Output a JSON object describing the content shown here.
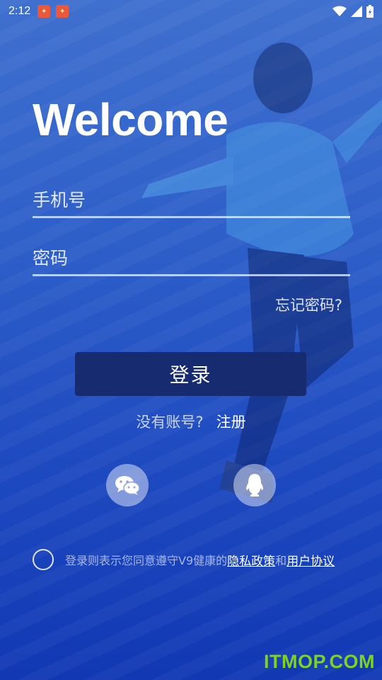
{
  "status_bar": {
    "time": "2:12",
    "icons": [
      "app-notification-icon",
      "app-notification-icon",
      "wifi-icon",
      "signal-icon",
      "battery-charging-icon"
    ]
  },
  "welcome_title": "Welcome",
  "phone_field": {
    "placeholder": "手机号",
    "value": ""
  },
  "password_field": {
    "placeholder": "密码",
    "value": ""
  },
  "forgot_password": "忘记密码?",
  "login_button": "登录",
  "register": {
    "prompt": "没有账号?",
    "link": "注册"
  },
  "social_login": [
    "wechat-icon",
    "qq-icon"
  ],
  "agreement": {
    "text": "登录则表示您同意遵守V9健康的",
    "privacy_link": "隐私政策",
    "and": "和",
    "user_agreement_link": "用户协议"
  },
  "watermark": "ITMOP.COM",
  "colors": {
    "background_top": "#3f70cf",
    "background_bottom": "#1238b4",
    "login_button": "#172c70",
    "watermark": "#7ed321"
  }
}
